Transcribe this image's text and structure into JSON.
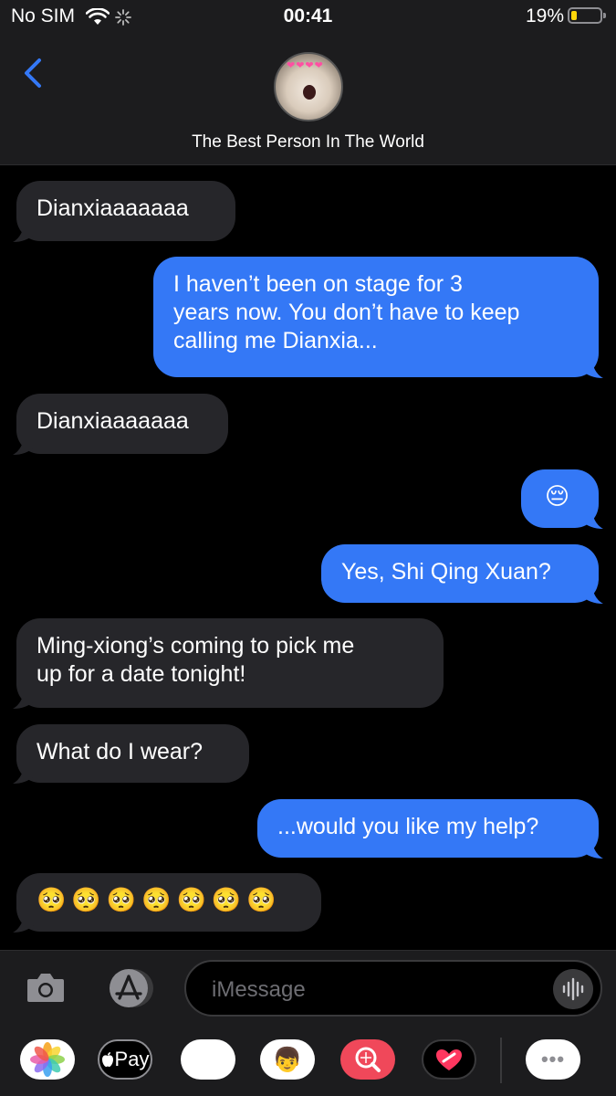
{
  "status": {
    "carrier": "No SIM",
    "time": "00:41",
    "battery": "19%",
    "battery_level": 0.19
  },
  "header": {
    "contact_name": "The Best Person In The World",
    "avatar_icon": "cat-avatar",
    "back_icon": "chevron-left-icon"
  },
  "messages": [
    {
      "from": "them",
      "lines": [
        "Dianxiaaaaaaa"
      ]
    },
    {
      "from": "me",
      "lines": [
        "I haven’t been on stage for 3",
        "years now. You don’t have to keep",
        "calling me Dianxia..."
      ]
    },
    {
      "from": "them",
      "lines": [
        "Dianxiaaaaaaa"
      ]
    },
    {
      "from": "me",
      "lines": [
        "😔"
      ]
    },
    {
      "from": "me",
      "lines": [
        "Yes, Shi Qing Xuan?"
      ]
    },
    {
      "from": "them",
      "lines": [
        "Ming-xiong’s coming to pick me",
        "up for a date tonight!"
      ]
    },
    {
      "from": "them",
      "lines": [
        "What do I wear?"
      ]
    },
    {
      "from": "me",
      "lines": [
        "...would you like my help?"
      ]
    },
    {
      "from": "them",
      "lines": [
        "🥺🥺🥺🥺🥺🥺🥺"
      ]
    }
  ],
  "composer": {
    "placeholder": "iMessage"
  },
  "apps": [
    {
      "name": "photos-app-icon",
      "label": ""
    },
    {
      "name": "apple-pay-app-icon",
      "label": "Pay"
    },
    {
      "name": "memoji-monkey-icon",
      "label": "🐵"
    },
    {
      "name": "memoji-stickers-icon",
      "label": "👦"
    },
    {
      "name": "image-search-icon",
      "label": ""
    },
    {
      "name": "digital-touch-icon",
      "label": ""
    },
    {
      "name": "more-apps-icon",
      "label": "•••"
    }
  ],
  "colors": {
    "outgoing": "#3478f6",
    "incoming": "#26262a",
    "accent": "#3478f6"
  }
}
